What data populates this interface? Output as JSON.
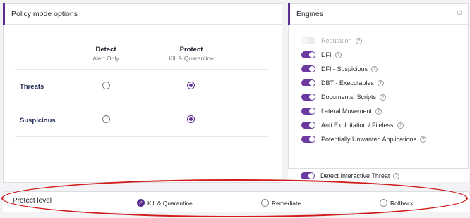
{
  "policy": {
    "title": "Policy mode options",
    "columns": [
      {
        "title": "Detect",
        "subtitle": "Alert Only"
      },
      {
        "title": "Protect",
        "subtitle": "Kill & Quarantine"
      }
    ],
    "rows": [
      {
        "label": "Threats",
        "selected": "Protect"
      },
      {
        "label": "Suspicious",
        "selected": "Protect"
      }
    ]
  },
  "engines": {
    "title": "Engines",
    "settings_icon": "gear-icon",
    "items": [
      {
        "label": "Reputation",
        "enabled": false,
        "disabled": true
      },
      {
        "label": "DFI",
        "enabled": true
      },
      {
        "label": "DFI - Suspicious",
        "enabled": true
      },
      {
        "label": "DBT - Executables",
        "enabled": true
      },
      {
        "label": "Documents, Scripts",
        "enabled": true
      },
      {
        "label": "Lateral Movement",
        "enabled": true
      },
      {
        "label": "Anti Exploitation / Fileless",
        "enabled": true
      },
      {
        "label": "Potentially Unwanted Applications",
        "enabled": true
      }
    ],
    "footer_item": {
      "label": "Detect Interactive Threat",
      "enabled": true
    }
  },
  "protect_level": {
    "label": "Protect level",
    "options": [
      {
        "label": "Kill & Quarantine",
        "selected": true
      },
      {
        "label": "Remediate",
        "selected": false
      },
      {
        "label": "Rollback",
        "selected": false
      }
    ]
  },
  "colors": {
    "accent": "#5b2e8f",
    "highlight": "#d01b1b"
  }
}
